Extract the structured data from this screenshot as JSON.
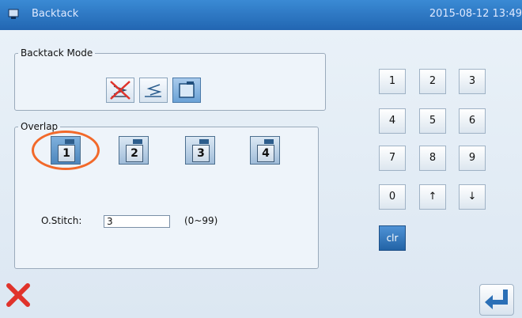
{
  "window": {
    "title": "Backtack",
    "datetime": "2015-08-12 13:49"
  },
  "backtack_mode": {
    "legend": "Backtack Mode",
    "options": [
      {
        "icon": "backtack-off-icon",
        "selected": false
      },
      {
        "icon": "backtack-stitch-icon",
        "selected": false
      },
      {
        "icon": "backtack-overlap-icon",
        "selected": true
      }
    ]
  },
  "overlap": {
    "legend": "Overlap",
    "options": [
      {
        "label": "1",
        "selected": true
      },
      {
        "label": "2",
        "selected": false
      },
      {
        "label": "3",
        "selected": false
      },
      {
        "label": "4",
        "selected": false
      }
    ],
    "stitch_label": "O.Stitch:",
    "stitch_value": "3",
    "stitch_range": "(0~99)"
  },
  "keypad": {
    "keys": [
      "1",
      "2",
      "3",
      "4",
      "5",
      "6",
      "7",
      "8",
      "9",
      "0",
      "↑",
      "↓"
    ],
    "clear": "clr"
  },
  "footer": {
    "cancel_icon": "close-x-icon",
    "enter_icon": "enter-return-icon"
  },
  "colors": {
    "titlebar": "#2266b2",
    "accent": "#2263a6",
    "cancel": "#e0332b",
    "highlight": "#f2692a"
  }
}
